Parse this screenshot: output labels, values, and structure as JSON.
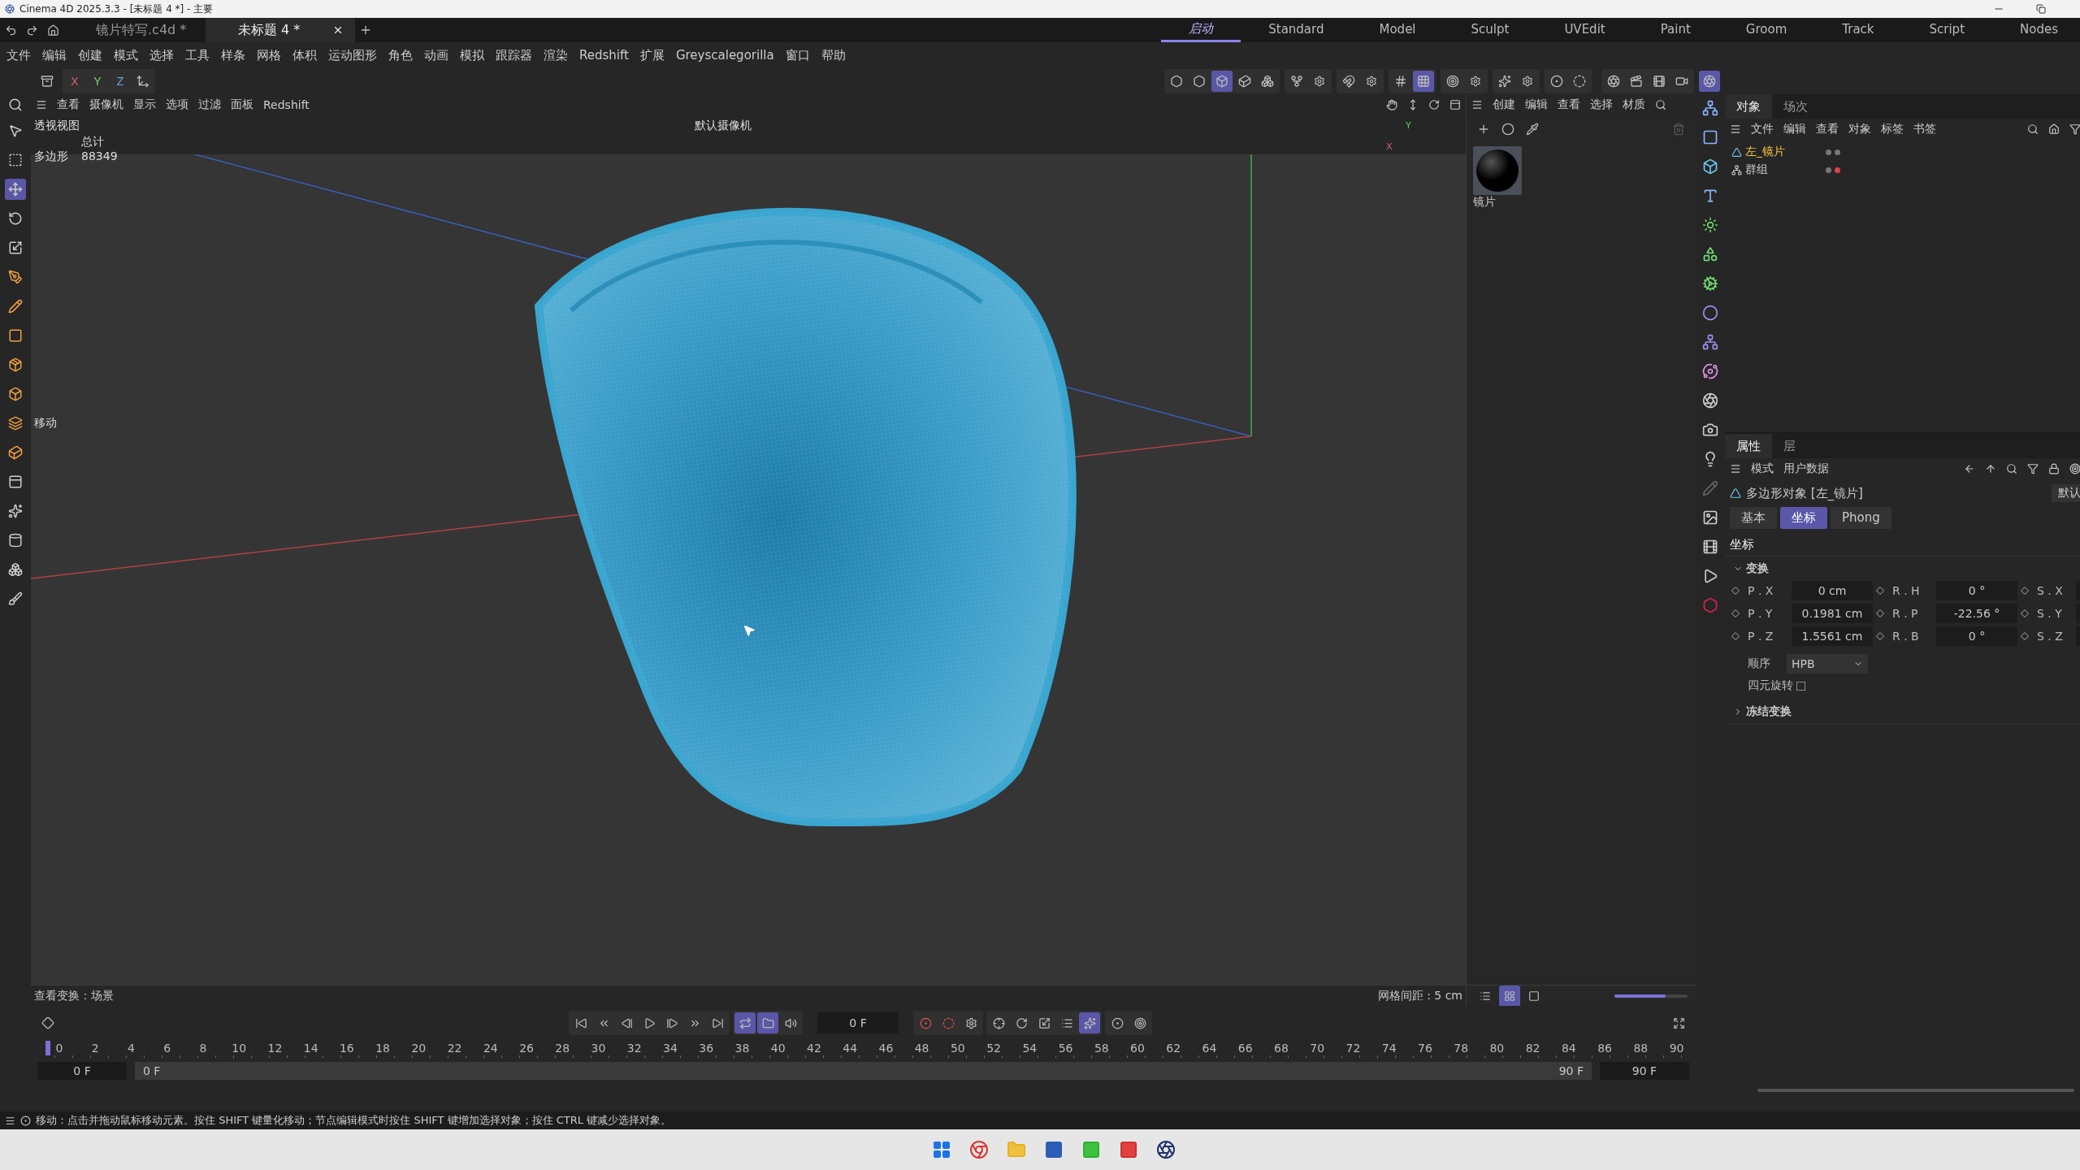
{
  "window": {
    "title": "Cinema 4D 2025.3.3 - [未标题 4 *] - 主要"
  },
  "doc_tabs": [
    {
      "label": "镜片特写.c4d *",
      "selected": false
    },
    {
      "label": "未标题 4 *",
      "selected": true
    }
  ],
  "layouts": [
    {
      "label": "启动",
      "selected": true
    },
    {
      "label": "Standard",
      "selected": false
    },
    {
      "label": "Model",
      "selected": false
    },
    {
      "label": "Sculpt",
      "selected": false
    },
    {
      "label": "UVEdit",
      "selected": false
    },
    {
      "label": "Paint",
      "selected": false
    },
    {
      "label": "Groom",
      "selected": false
    },
    {
      "label": "Track",
      "selected": false
    },
    {
      "label": "Script",
      "selected": false
    },
    {
      "label": "Nodes",
      "selected": false
    }
  ],
  "menu": [
    "文件",
    "编辑",
    "创建",
    "模式",
    "选择",
    "工具",
    "样条",
    "网格",
    "体积",
    "运动图形",
    "角色",
    "动画",
    "模拟",
    "跟踪器",
    "渲染",
    "Redshift",
    "扩展",
    "Greyscalegorilla",
    "窗口",
    "帮助"
  ],
  "axis_buttons": [
    {
      "label": "X",
      "color": "#e0606e"
    },
    {
      "label": "Y",
      "color": "#7ad46a"
    },
    {
      "label": "Z",
      "color": "#6aa8e0"
    }
  ],
  "toolbar_modes": [
    {
      "selected": false
    },
    {
      "selected": false
    },
    {
      "selected": true
    },
    {
      "selected": false
    },
    {
      "selected": false
    }
  ],
  "snap_buttons": [
    {
      "selected": false
    },
    {
      "selected": true
    }
  ],
  "left_tools": [
    {
      "selected": false
    },
    {
      "selected": false
    },
    {
      "selected": true
    },
    {
      "selected": false
    },
    {
      "selected": false
    },
    {
      "selected": false
    },
    {
      "selected": false
    },
    {
      "selected": false
    },
    {
      "selected": false
    },
    {
      "selected": false
    },
    {
      "selected": false
    },
    {
      "selected": false
    },
    {
      "selected": false
    },
    {
      "selected": false
    },
    {
      "selected": false
    },
    {
      "selected": false
    },
    {
      "selected": false
    }
  ],
  "viewport": {
    "menu": [
      "查看",
      "摄像机",
      "显示",
      "选项",
      "过滤",
      "面板",
      "Redshift"
    ],
    "title": "透视视图",
    "camera": "默认摄像机",
    "stats_header": "总计",
    "stats_label": "多边形",
    "stats_value": "88349",
    "tool_label": "移动",
    "gizmo_labels": [
      "Y",
      "X"
    ],
    "footer_left": "查看变换：场景",
    "footer_right": "网格间距 : 5 cm"
  },
  "materials": {
    "menu": [
      "创建",
      "编辑",
      "查看",
      "选择",
      "材质"
    ],
    "items": [
      {
        "name": "镜片"
      }
    ],
    "zoom": {
      "level": 0.7
    }
  },
  "objects": {
    "tabs": [
      {
        "label": "对象",
        "selected": true
      },
      {
        "label": "场次",
        "selected": false
      }
    ],
    "menu": [
      "文件",
      "编辑",
      "查看",
      "对象",
      "标签",
      "书签"
    ],
    "tree": [
      {
        "name": "左_镜片",
        "selected": true,
        "kind": "polygon"
      },
      {
        "name": "群组",
        "selected": false,
        "kind": "group"
      }
    ]
  },
  "attributes": {
    "tabs": [
      {
        "label": "属性",
        "selected": true
      },
      {
        "label": "层",
        "selected": false
      }
    ],
    "menu": [
      "模式",
      "用户数据"
    ],
    "object_title": "多边形对象 [左_镜片]",
    "preset": "默认",
    "sub_tabs": [
      {
        "label": "基本",
        "selected": false
      },
      {
        "label": "坐标",
        "selected": true
      },
      {
        "label": "Phong",
        "selected": false
      }
    ],
    "section": "坐标",
    "group": {
      "label": "变换",
      "expanded": true
    },
    "rows": [
      {
        "p_label": "P . X",
        "p_value": "0 cm",
        "r_label": "R . H",
        "r_value": "0 °",
        "s_label": "S . X"
      },
      {
        "p_label": "P . Y",
        "p_value": "0.1981 cm",
        "r_label": "R . P",
        "r_value": "-22.56 °",
        "s_label": "S . Y"
      },
      {
        "p_label": "P . Z",
        "p_value": "1.5561 cm",
        "r_label": "R . B",
        "r_value": "0 °",
        "s_label": "S . Z"
      }
    ],
    "order_label": "顺序",
    "order_value": "HPB",
    "quaternion": {
      "label": "四元旋转",
      "checked": false
    },
    "freeze": {
      "label": "冻结变换",
      "expanded": false
    }
  },
  "timeline": {
    "frame": "0 F",
    "ruler": [
      "0",
      "2",
      "4",
      "6",
      "8",
      "10",
      "12",
      "14",
      "16",
      "18",
      "20",
      "22",
      "24",
      "26",
      "28",
      "30",
      "32",
      "34",
      "36",
      "38",
      "40",
      "42",
      "44",
      "46",
      "48",
      "50",
      "52",
      "54",
      "56",
      "58",
      "60",
      "62",
      "64",
      "66",
      "68",
      "70",
      "72",
      "74",
      "76",
      "78",
      "80",
      "82",
      "84",
      "86",
      "88",
      "90"
    ],
    "start": "0 F",
    "range_start": "0 F",
    "range_end": "90 F",
    "end": "90 F",
    "loop": {
      "selected": true
    }
  },
  "status": "移动：点击并拖动鼠标移动元素。按住 SHIFT 键量化移动；节点编辑模式时按住 SHIFT 键增加选择对象；按住 CTRL 键减少选择对象。"
}
